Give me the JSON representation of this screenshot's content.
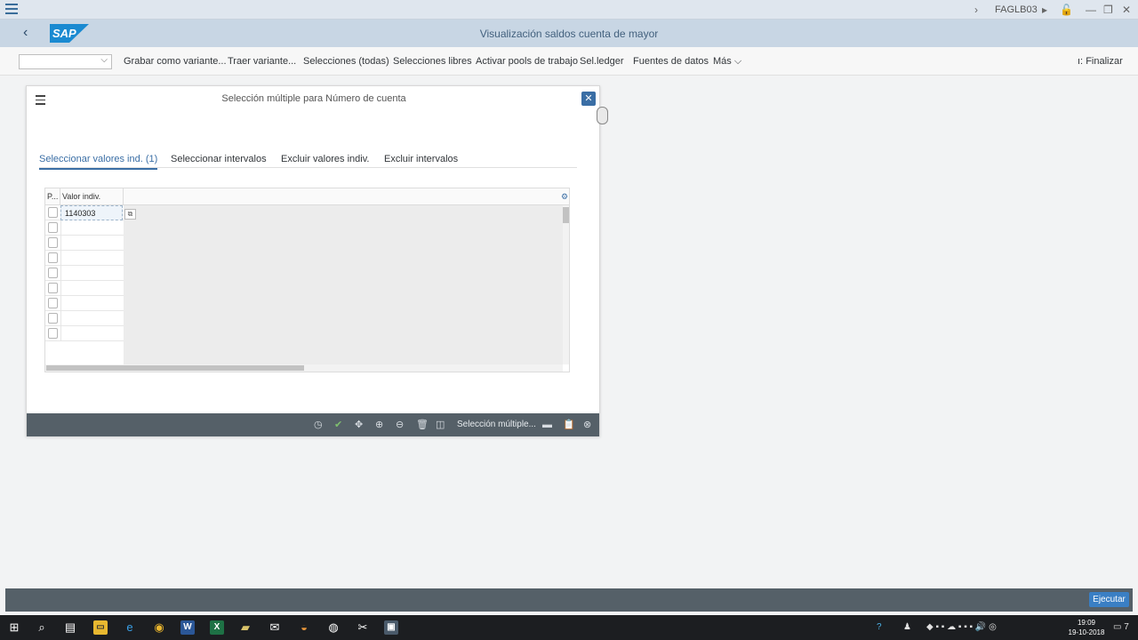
{
  "window": {
    "tcode": "FAGLB03",
    "chevron": "›"
  },
  "shell": {
    "back_glyph": "‹",
    "logo_text": "SAP",
    "title": "Visualización saldos cuenta de mayor"
  },
  "toolbar": {
    "combo_value": "",
    "items": [
      "Grabar como variante...",
      "Traer variante...",
      "Selecciones (todas)",
      "Selecciones libres",
      "Activar pools de trabajo",
      "Sel.ledger",
      "Fuentes de datos",
      "Más"
    ],
    "finalize": "Finalizar"
  },
  "dialog": {
    "title": "Selección múltiple para Número de cuenta",
    "tabs": [
      "Seleccionar valores ind. (1)",
      "Seleccionar intervalos",
      "Excluir valores indiv.",
      "Excluir intervalos"
    ],
    "active_tab": 0,
    "grid": {
      "col_p": "P...",
      "col_value": "Valor indiv.",
      "rows": [
        "1140303",
        "",
        "",
        "",
        "",
        "",
        "",
        "",
        ""
      ]
    },
    "footer_text": "Selección múltiple..."
  },
  "status": {
    "execute": "Ejecutar"
  },
  "taskbar": {
    "time": "19:09",
    "date": "19-10-2018",
    "notifications": "7"
  }
}
